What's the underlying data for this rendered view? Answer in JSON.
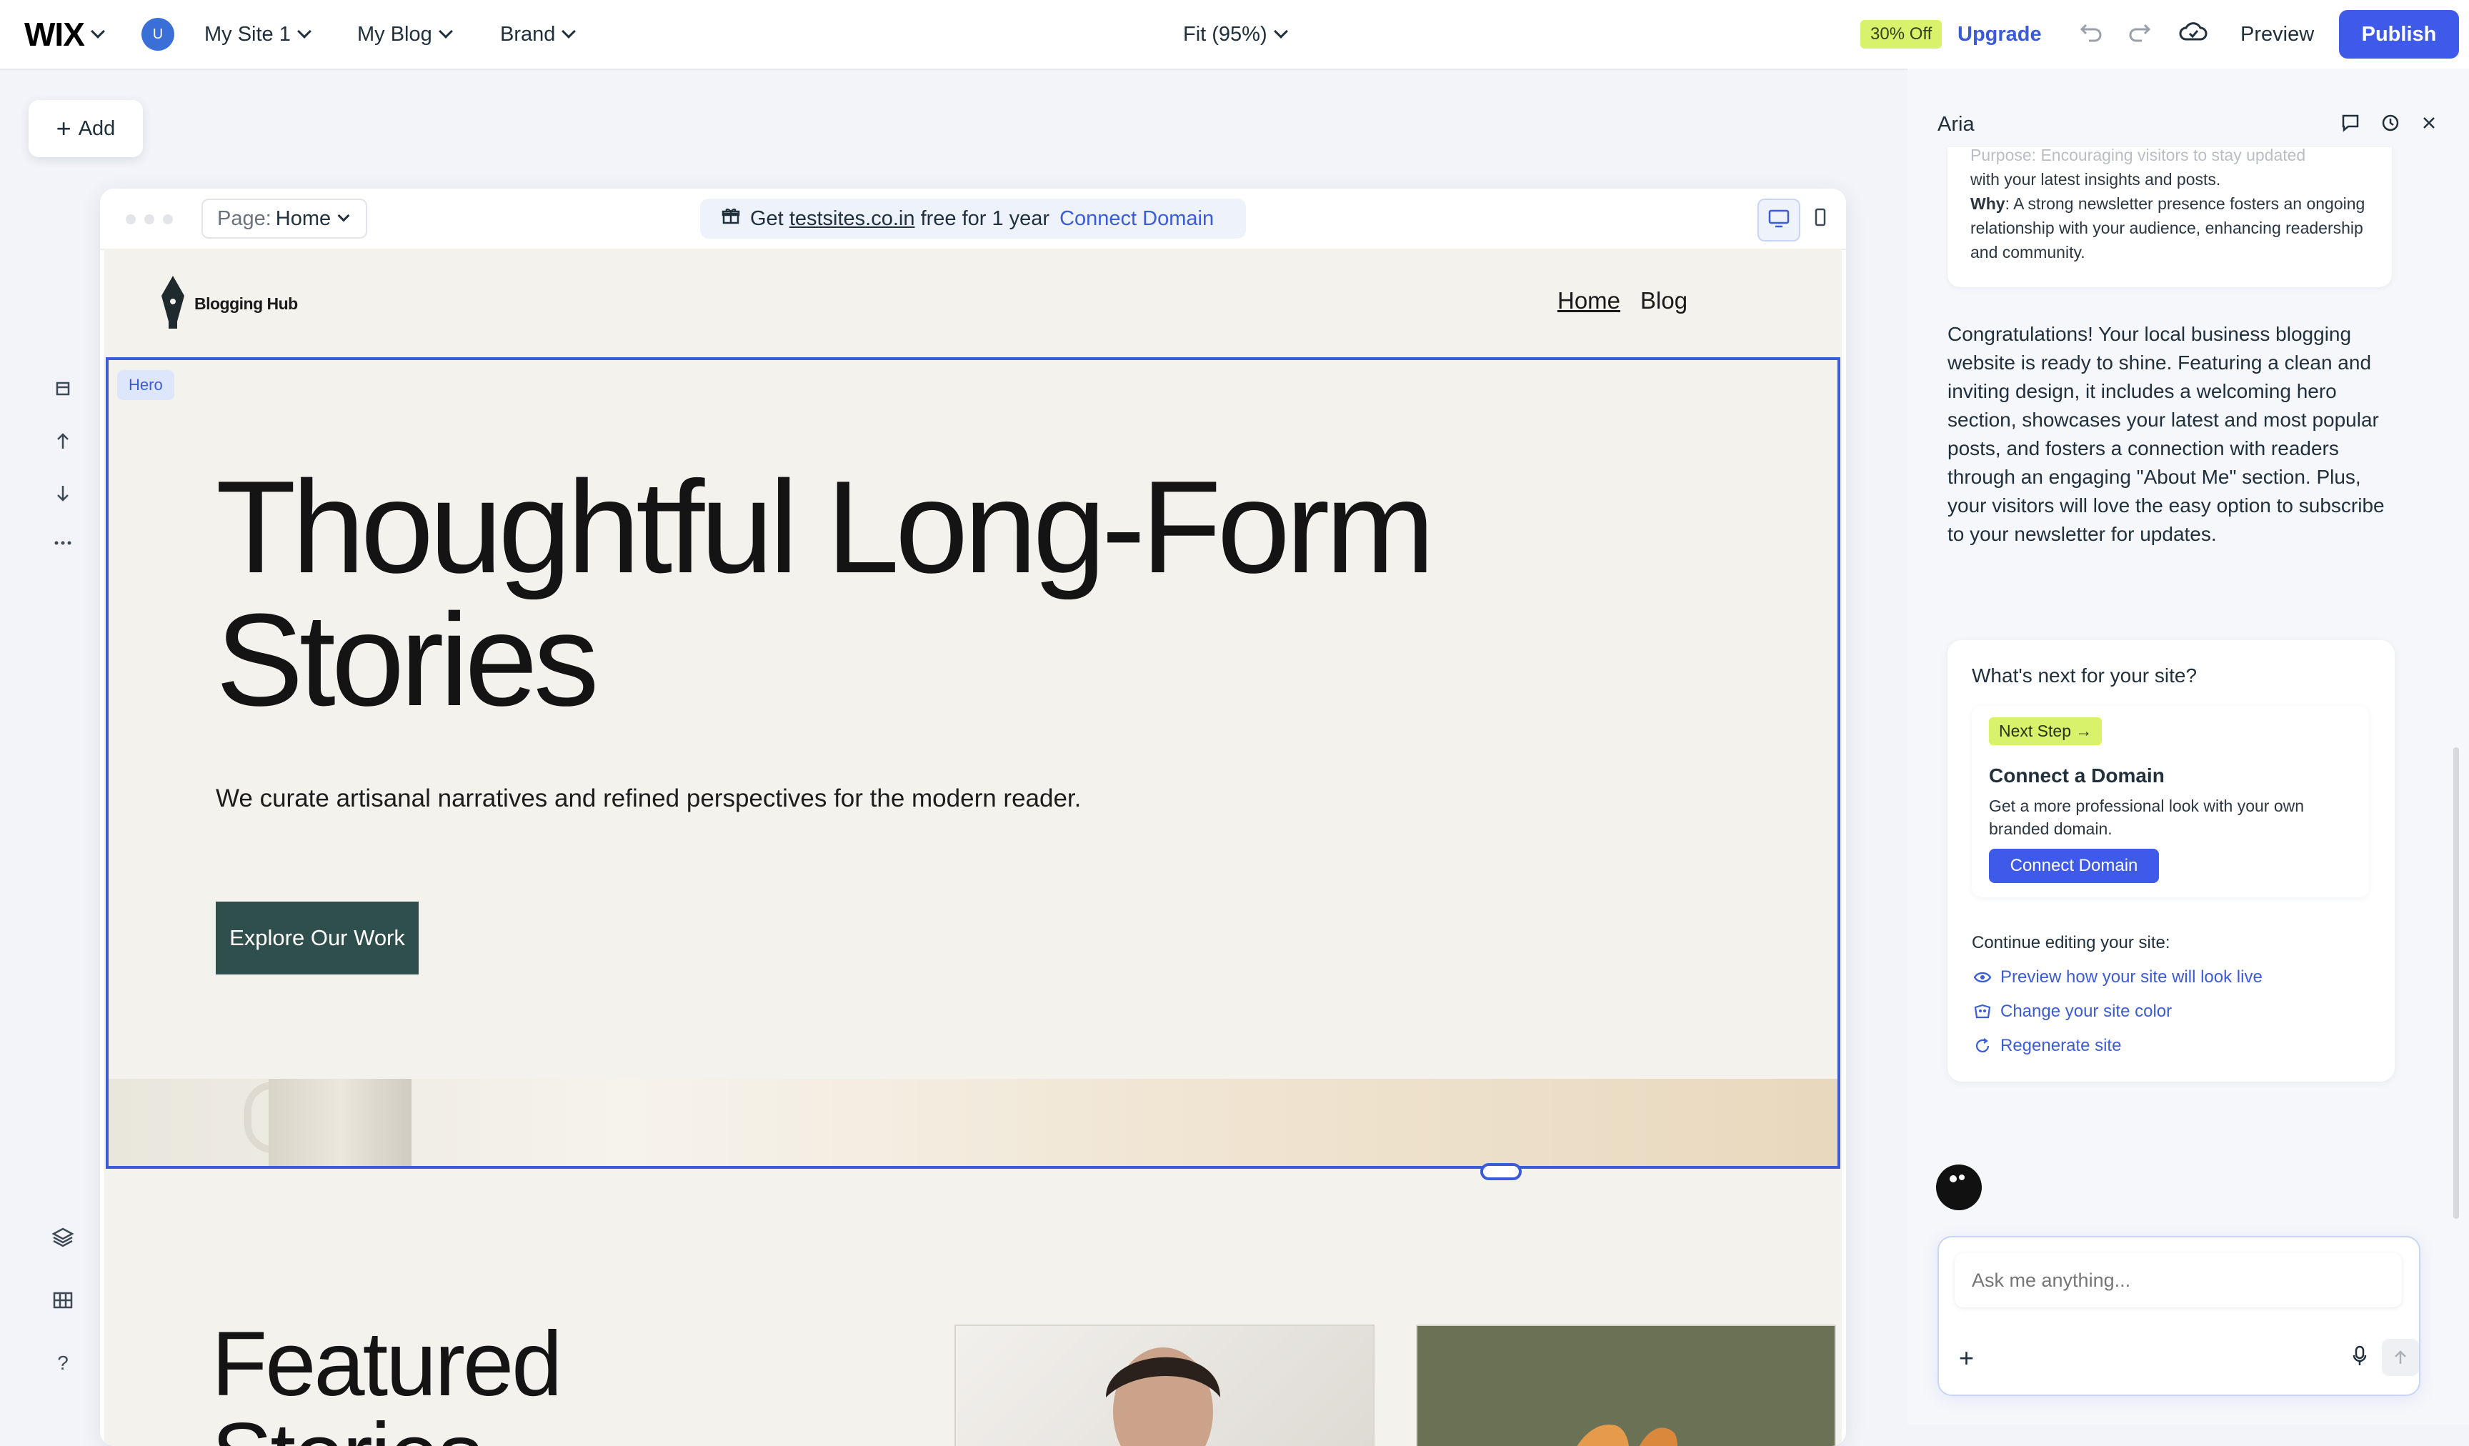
{
  "topbar": {
    "logo": "WIX",
    "avatar_initial": "U",
    "site_name": "My Site 1",
    "blog_menu": "My Blog",
    "brand_menu": "Brand",
    "zoom": "Fit (95%)",
    "discount_badge": "30% Off",
    "upgrade": "Upgrade",
    "preview": "Preview",
    "publish": "Publish"
  },
  "leftbar": {
    "add_label": "Add"
  },
  "canvas_bar": {
    "page_label": "Page:",
    "page_value": "Home",
    "promo_prefix": "Get",
    "promo_domain": "testsites.co.in",
    "promo_suffix": "free for 1 year",
    "promo_link": "Connect Domain"
  },
  "site": {
    "logo_text": "Blogging Hub",
    "nav": [
      "Home",
      "Blog"
    ],
    "hero_tag": "Hero",
    "hero_title_line1": "Thoughtful Long-Form",
    "hero_title_line2": "Stories",
    "hero_subtitle": "We curate artisanal narratives and refined perspectives for the modern reader.",
    "hero_button": "Explore Our Work",
    "featured_line1": "Featured",
    "featured_line2": "Stories"
  },
  "panel": {
    "title": "Aria",
    "prev_card_faded": "Purpose: Encouraging visitors to stay updated",
    "prev_card_line": "with your latest insights and posts.",
    "prev_card_why_label": "Why",
    "prev_card_why_text": ": A strong newsletter presence fosters an ongoing relationship with your audience, enhancing readership and community.",
    "congrats": "Congratulations! Your local business blogging website is ready to shine. Featuring a clean and inviting design, it includes a welcoming hero section, showcases your latest and most popular posts, and fosters a connection with readers through an engaging \"About Me\" section. Plus, your visitors will love the easy option to subscribe to your newsletter for updates.",
    "next_question": "What's next for your site?",
    "next_step_badge": "Next Step",
    "connect_title": "Connect a Domain",
    "connect_desc": "Get a more professional look with your own branded domain.",
    "connect_button": "Connect Domain",
    "continue_label": "Continue editing your site:",
    "links": [
      "Preview how your site will look live",
      "Change your site color",
      "Regenerate site"
    ],
    "chat_placeholder": "Ask me anything..."
  },
  "colors": {
    "accent": "#3f5ae8",
    "selection": "#3b5bd9",
    "badge_lime": "#d9f26b",
    "hero_button": "#2f4f4d",
    "site_bg": "#f3f2ec"
  }
}
